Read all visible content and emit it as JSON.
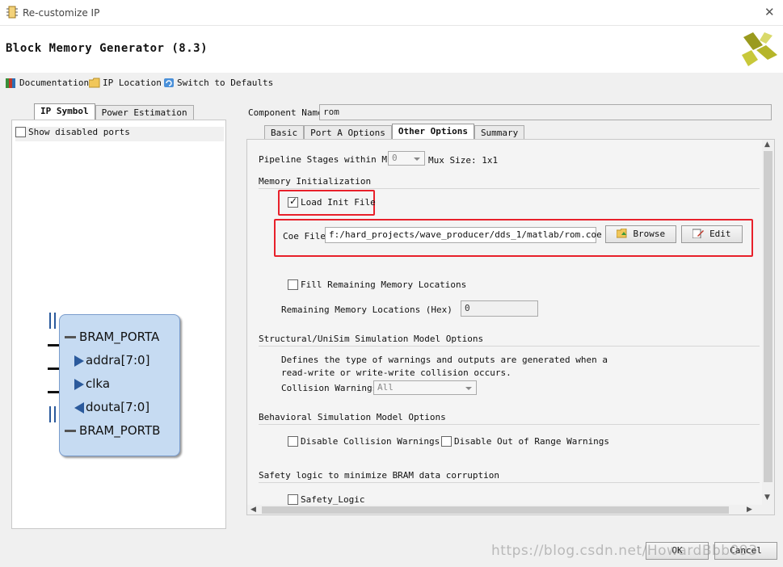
{
  "window": {
    "title": "Re-customize IP",
    "close_glyph": "✕"
  },
  "header": {
    "title": "Block Memory Generator (8.3)"
  },
  "toolbar": {
    "items": [
      {
        "label": "Documentation",
        "icon": "book-icon"
      },
      {
        "label": "IP Location",
        "icon": "folder-icon"
      },
      {
        "label": "Switch to Defaults",
        "icon": "refresh-icon"
      }
    ]
  },
  "left": {
    "tabs": [
      "IP Symbol",
      "Power Estimation"
    ],
    "show_disabled": "Show disabled ports",
    "symbol": {
      "pins": [
        "BRAM_PORTA",
        "addra[7:0]",
        "clka",
        "douta[7:0]",
        "BRAM_PORTB"
      ]
    }
  },
  "right": {
    "component_name_label": "Component Name",
    "component_name_value": "rom",
    "tabs": [
      "Basic",
      "Port A Options",
      "Other Options",
      "Summary"
    ],
    "pipeline": {
      "label": "Pipeline Stages within Mux",
      "value": "0",
      "mux_size": "Mux Size: 1x1"
    },
    "mem_init": {
      "section": "Memory Initialization",
      "load_init": "Load Init File",
      "coe_label": "Coe File",
      "coe_value": "f:/hard_projects/wave_producer/dds_1/matlab/rom.coe",
      "browse": "Browse",
      "edit": "Edit",
      "fill_remaining": "Fill Remaining Memory Locations",
      "remaining_label": "Remaining Memory Locations (Hex)",
      "remaining_value": "0"
    },
    "structural": {
      "section": "Structural/UniSim Simulation Model Options",
      "desc1": "Defines the type of warnings and outputs are generated when a",
      "desc2": "read-write or write-write collision occurs.",
      "collision_label": "Collision Warnings",
      "collision_value": "All"
    },
    "behavioral": {
      "section": "Behavioral Simulation Model Options",
      "disable_collision": "Disable Collision Warnings",
      "disable_oor": "Disable Out of Range Warnings"
    },
    "safety": {
      "section": "Safety logic to minimize BRAM data corruption",
      "label": "Safety_Logic"
    }
  },
  "footer": {
    "ok": "OK",
    "cancel": "Cancel",
    "watermark": "https://blog.csdn.net/HowardBbb093"
  },
  "colors": {
    "highlight": "#e8202a",
    "symbol_fill": "#c6dbf2",
    "logo_yellow": "#b5b52a"
  }
}
